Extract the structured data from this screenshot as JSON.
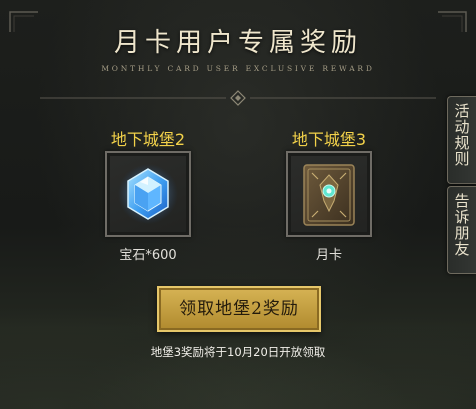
{
  "header": {
    "title": "月卡用户专属奖励",
    "subtitle": "MONTHLY CARD USER EXCLUSIVE REWARD"
  },
  "rewards": [
    {
      "name": "地下城堡2",
      "item_label": "宝石*600",
      "icon": "blue-gem-icon"
    },
    {
      "name": "地下城堡3",
      "item_label": "月卡",
      "icon": "monthly-card-book-icon"
    }
  ],
  "side_tabs": {
    "rules": "活动规则",
    "share": "告诉朋友"
  },
  "claim_button": {
    "label": "领取地堡2奖励"
  },
  "notice": "地堡3奖励将于10月20日开放领取",
  "colors": {
    "accent_gold": "#f3d24a",
    "button_gold": "#d6b354",
    "background": "#141615"
  }
}
